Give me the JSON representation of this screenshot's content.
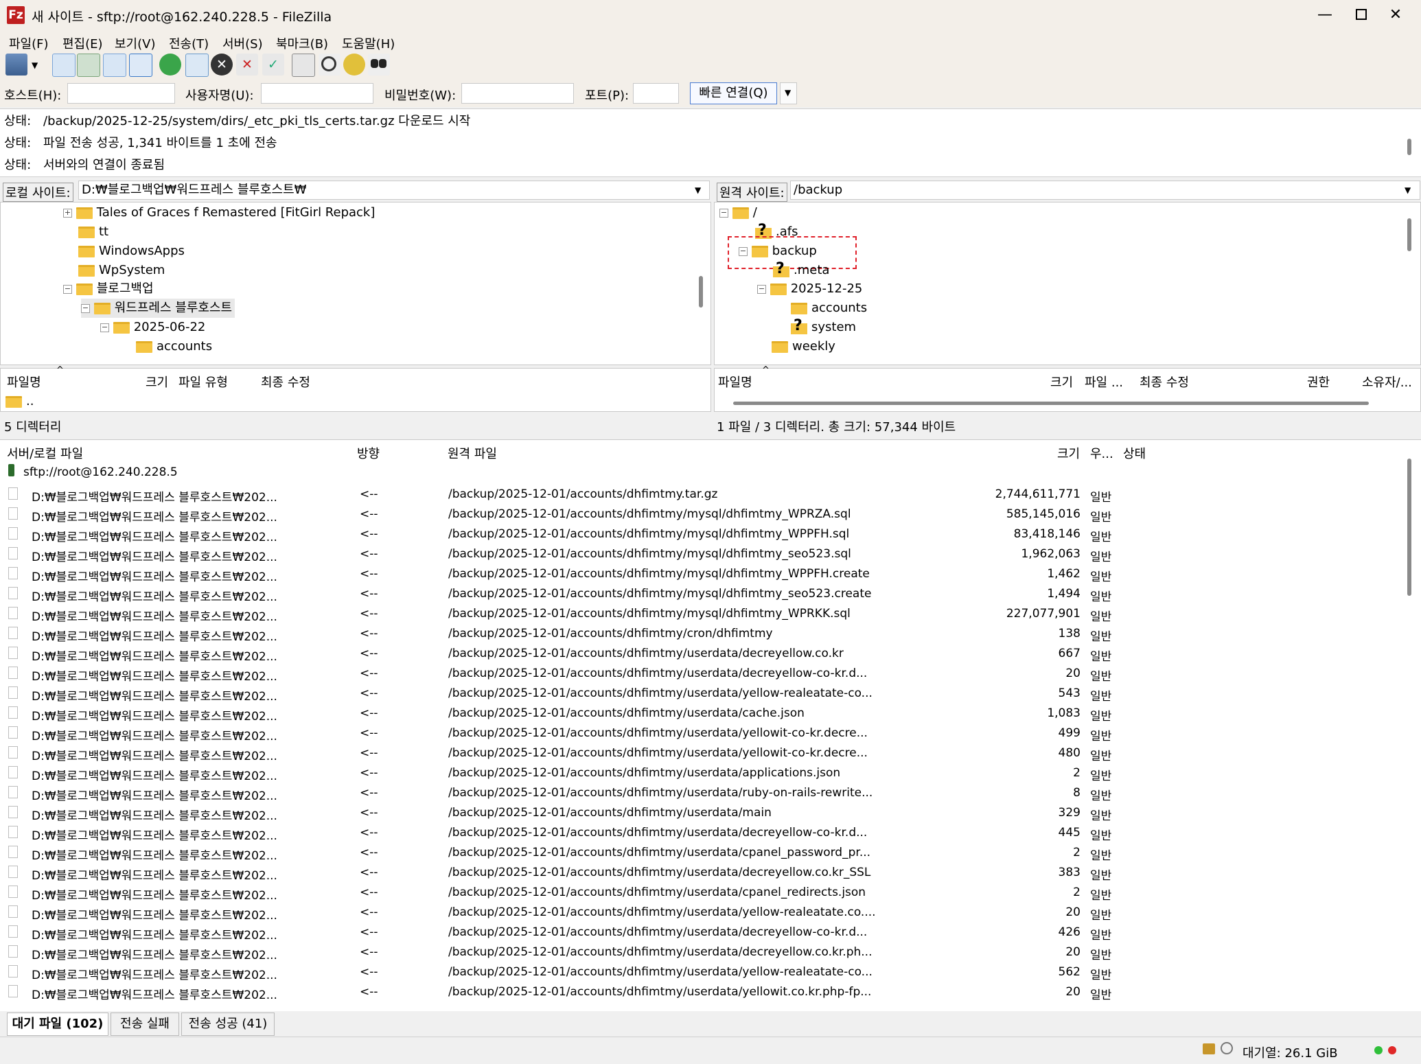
{
  "window": {
    "title": "새 사이트 - sftp://root@162.240.228.5 - FileZilla",
    "app_icon_text": "Fz",
    "min_glyph": "—",
    "max_glyph": "☐",
    "close_glyph": "✕"
  },
  "menu": [
    {
      "label": "파일(F)"
    },
    {
      "label": "편집(E)"
    },
    {
      "label": "보기(V)"
    },
    {
      "label": "전송(T)"
    },
    {
      "label": "서버(S)"
    },
    {
      "label": "북마크(B)"
    },
    {
      "label": "도움말(H)"
    }
  ],
  "toolbar": {
    "icons": [
      "site-manager-icon",
      "toggle-log-icon",
      "toggle-local-tree-icon",
      "toggle-remote-tree-icon",
      "toggle-queue-icon",
      "refresh-icon",
      "process-queue-icon",
      "cancel-icon",
      "disconnect-icon",
      "reconnect-icon",
      "filter-icon",
      "compare-icon",
      "sync-browse-icon",
      "search-icon"
    ]
  },
  "quickconnect": {
    "host_label": "호스트(H):",
    "user_label": "사용자명(U):",
    "pass_label": "비밀번호(W):",
    "port_label": "포트(P):",
    "host_value": "",
    "user_value": "",
    "pass_value": "",
    "port_value": "",
    "connect_label": "빠른 연결(Q)"
  },
  "log": [
    {
      "key": "상태:",
      "text": "/backup/2025-12-25/system/dirs/_etc_pki_tls_certs.tar.gz 다운로드 시작"
    },
    {
      "key": "상태:",
      "text": "파일 전송 성공, 1,341 바이트를 1 초에 전송"
    },
    {
      "key": "상태:",
      "text": "서버와의 연결이 종료됨"
    }
  ],
  "local": {
    "site_label": "로컬 사이트:",
    "path": "D:₩블로그백업₩워드프레스 블루호스트₩",
    "tree": [
      {
        "label": "Tales of Graces f Remastered [FitGirl Repack]",
        "expander": "+"
      },
      {
        "label": "tt"
      },
      {
        "label": "WindowsApps"
      },
      {
        "label": "WpSystem"
      },
      {
        "label": "블로그백업",
        "expander": "−"
      },
      {
        "label": "워드프레스 블루호스트",
        "expander": "−"
      },
      {
        "label": "2025-06-22",
        "expander": "−"
      },
      {
        "label": "accounts"
      }
    ],
    "columns": {
      "name": "파일명",
      "size": "크기",
      "type": "파일 유형",
      "modified": "최종 수정"
    },
    "rows": [
      {
        "name": ".."
      }
    ],
    "status": "5 디렉터리"
  },
  "remote": {
    "site_label": "원격 사이트:",
    "path": "/backup",
    "tree": [
      {
        "label": "/",
        "expander": "−"
      },
      {
        "label": ".afs",
        "unknown": true
      },
      {
        "label": "backup",
        "expander": "−"
      },
      {
        "label": ".meta",
        "unknown": true
      },
      {
        "label": "2025-12-25",
        "expander": "−"
      },
      {
        "label": "accounts"
      },
      {
        "label": "system",
        "unknown": true
      },
      {
        "label": "weekly"
      }
    ],
    "columns": {
      "name": "파일명",
      "size": "크기",
      "type": "파일 ...",
      "modified": "최종 수정",
      "perm": "권한",
      "owner": "소유자/..."
    },
    "status": "1 파일 / 3 디렉터리. 총 크기: 57,344 바이트"
  },
  "queue": {
    "columns": {
      "local": "서버/로컬 파일",
      "direction": "방향",
      "remote": "원격 파일",
      "size": "크기",
      "priority": "우...",
      "status": "상태"
    },
    "server": "sftp://root@162.240.228.5",
    "local_prefix": "D:₩블로그백업₩워드프레스 블루호스트₩202...",
    "direction": "<--",
    "priority": "일반",
    "items": [
      {
        "remote": "/backup/2025-12-01/accounts/dhfimtmy.tar.gz",
        "size": "2,744,611,771"
      },
      {
        "remote": "/backup/2025-12-01/accounts/dhfimtmy/mysql/dhfimtmy_WPRZA.sql",
        "size": "585,145,016"
      },
      {
        "remote": "/backup/2025-12-01/accounts/dhfimtmy/mysql/dhfimtmy_WPPFH.sql",
        "size": "83,418,146"
      },
      {
        "remote": "/backup/2025-12-01/accounts/dhfimtmy/mysql/dhfimtmy_seo523.sql",
        "size": "1,962,063"
      },
      {
        "remote": "/backup/2025-12-01/accounts/dhfimtmy/mysql/dhfimtmy_WPPFH.create",
        "size": "1,462"
      },
      {
        "remote": "/backup/2025-12-01/accounts/dhfimtmy/mysql/dhfimtmy_seo523.create",
        "size": "1,494"
      },
      {
        "remote": "/backup/2025-12-01/accounts/dhfimtmy/mysql/dhfimtmy_WPRKK.sql",
        "size": "227,077,901"
      },
      {
        "remote": "/backup/2025-12-01/accounts/dhfimtmy/cron/dhfimtmy",
        "size": "138"
      },
      {
        "remote": "/backup/2025-12-01/accounts/dhfimtmy/userdata/decreyellow.co.kr",
        "size": "667"
      },
      {
        "remote": "/backup/2025-12-01/accounts/dhfimtmy/userdata/decreyellow-co-kr.d...",
        "size": "20"
      },
      {
        "remote": "/backup/2025-12-01/accounts/dhfimtmy/userdata/yellow-realeatate-co...",
        "size": "543"
      },
      {
        "remote": "/backup/2025-12-01/accounts/dhfimtmy/userdata/cache.json",
        "size": "1,083"
      },
      {
        "remote": "/backup/2025-12-01/accounts/dhfimtmy/userdata/yellowit-co-kr.decre...",
        "size": "499"
      },
      {
        "remote": "/backup/2025-12-01/accounts/dhfimtmy/userdata/yellowit-co-kr.decre...",
        "size": "480"
      },
      {
        "remote": "/backup/2025-12-01/accounts/dhfimtmy/userdata/applications.json",
        "size": "2"
      },
      {
        "remote": "/backup/2025-12-01/accounts/dhfimtmy/userdata/ruby-on-rails-rewrite...",
        "size": "8"
      },
      {
        "remote": "/backup/2025-12-01/accounts/dhfimtmy/userdata/main",
        "size": "329"
      },
      {
        "remote": "/backup/2025-12-01/accounts/dhfimtmy/userdata/decreyellow-co-kr.d...",
        "size": "445"
      },
      {
        "remote": "/backup/2025-12-01/accounts/dhfimtmy/userdata/cpanel_password_pr...",
        "size": "2"
      },
      {
        "remote": "/backup/2025-12-01/accounts/dhfimtmy/userdata/decreyellow.co.kr_SSL",
        "size": "383"
      },
      {
        "remote": "/backup/2025-12-01/accounts/dhfimtmy/userdata/cpanel_redirects.json",
        "size": "2"
      },
      {
        "remote": "/backup/2025-12-01/accounts/dhfimtmy/userdata/yellow-realeatate.co....",
        "size": "20"
      },
      {
        "remote": "/backup/2025-12-01/accounts/dhfimtmy/userdata/decreyellow-co-kr.d...",
        "size": "426"
      },
      {
        "remote": "/backup/2025-12-01/accounts/dhfimtmy/userdata/decreyellow.co.kr.ph...",
        "size": "20"
      },
      {
        "remote": "/backup/2025-12-01/accounts/dhfimtmy/userdata/yellow-realeatate-co...",
        "size": "562"
      },
      {
        "remote": "/backup/2025-12-01/accounts/dhfimtmy/userdata/yellowit.co.kr.php-fp...",
        "size": "20"
      }
    ]
  },
  "tabs": [
    {
      "label": "대기 파일 (102)"
    },
    {
      "label": "전송 실패"
    },
    {
      "label": "전송 성공 (41)"
    }
  ],
  "statusbar": {
    "queue_label": "대기열: 26.1 GiB"
  },
  "colors": {
    "accent": "#4a7bd1",
    "selection_box": "#e0202a",
    "folder": "#f5c542",
    "app_icon": "#bf1f1f"
  }
}
